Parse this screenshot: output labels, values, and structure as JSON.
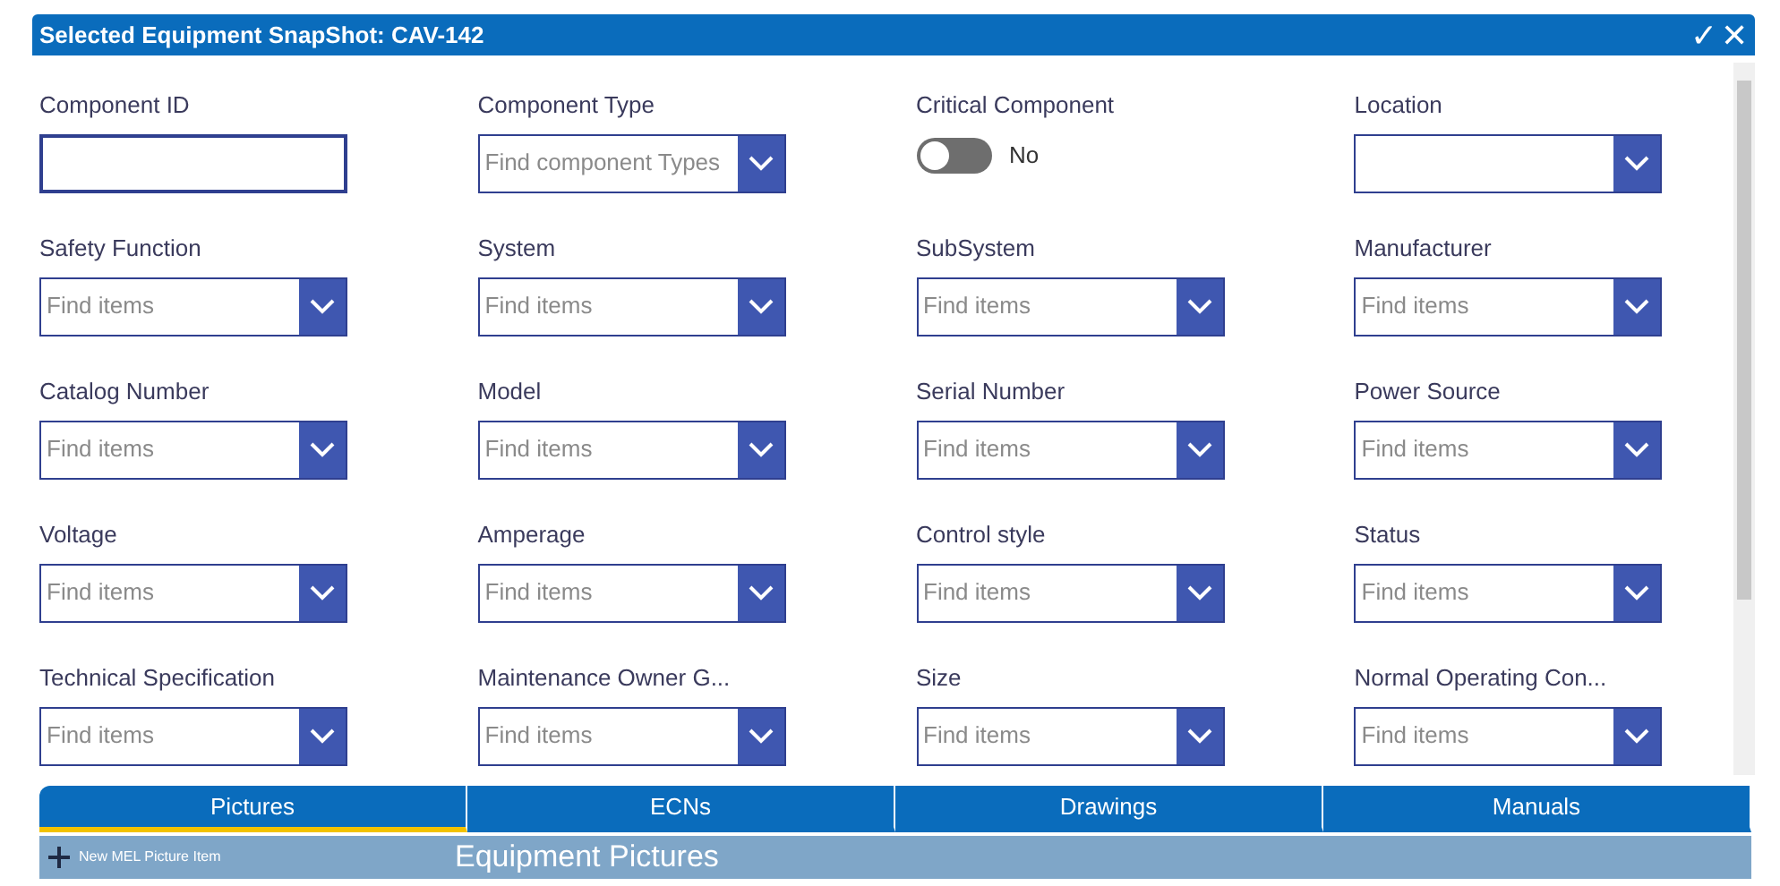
{
  "header": {
    "title": "Selected Equipment SnapShot: CAV-142",
    "actions": [
      "✓",
      "✕"
    ]
  },
  "fields": [
    {
      "label": "Component ID",
      "kind": "text"
    },
    {
      "label": "Component Type",
      "kind": "dropdown",
      "placeholder": "Find component Types"
    },
    {
      "label": "Critical Component",
      "kind": "toggle",
      "on": false,
      "value": "No"
    },
    {
      "label": "Location",
      "kind": "dropdown"
    },
    {
      "label": "Safety Function",
      "kind": "dropdown",
      "placeholder": "Find items"
    },
    {
      "label": "System",
      "kind": "dropdown",
      "placeholder": "Find items"
    },
    {
      "label": "SubSystem",
      "kind": "dropdown",
      "placeholder": "Find items"
    },
    {
      "label": "Manufacturer",
      "kind": "dropdown",
      "placeholder": "Find items"
    },
    {
      "label": "Catalog Number",
      "kind": "dropdown",
      "placeholder": "Find items"
    },
    {
      "label": "Model",
      "kind": "dropdown",
      "placeholder": "Find items"
    },
    {
      "label": "Serial Number",
      "kind": "dropdown",
      "placeholder": "Find items"
    },
    {
      "label": "Power Source",
      "kind": "dropdown",
      "placeholder": "Find items"
    },
    {
      "label": "Voltage",
      "kind": "dropdown",
      "placeholder": "Find items"
    },
    {
      "label": "Amperage",
      "kind": "dropdown",
      "placeholder": "Find items"
    },
    {
      "label": "Control style",
      "kind": "dropdown",
      "placeholder": "Find items"
    },
    {
      "label": "Status",
      "kind": "dropdown",
      "placeholder": "Find items"
    },
    {
      "label": "Technical Specification",
      "kind": "dropdown",
      "placeholder": "Find items"
    },
    {
      "label": "Maintenance Owner G...",
      "kind": "dropdown",
      "placeholder": "Find items"
    },
    {
      "label": "Size",
      "kind": "dropdown",
      "placeholder": "Find items"
    },
    {
      "label": "Normal Operating Con...",
      "kind": "dropdown",
      "placeholder": "Find items"
    }
  ],
  "tabs": [
    {
      "label": "Pictures",
      "selected": true
    },
    {
      "label": "ECNs",
      "selected": false
    },
    {
      "label": "Drawings",
      "selected": false
    },
    {
      "label": "Manuals",
      "selected": false
    }
  ],
  "gallery_bar": {
    "new_item": "New MEL Picture Item",
    "title": "Equipment Pictures"
  }
}
